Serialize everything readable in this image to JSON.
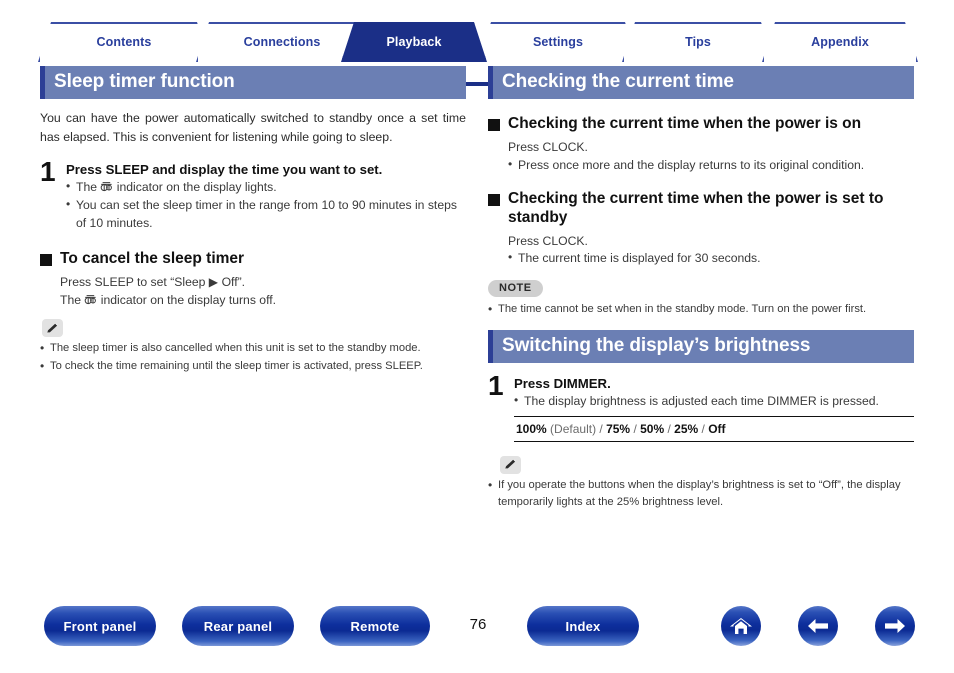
{
  "nav_tabs": [
    {
      "label": "Contents",
      "active": false
    },
    {
      "label": "Connections",
      "active": false
    },
    {
      "label": "Playback",
      "active": true
    },
    {
      "label": "Settings",
      "active": false
    },
    {
      "label": "Tips",
      "active": false
    },
    {
      "label": "Appendix",
      "active": false
    }
  ],
  "left_column": {
    "section_title": "Sleep timer function",
    "intro": "You can have the power automatically switched to standby once a set time has elapsed. This is convenient for listening while going to sleep.",
    "step": {
      "number": "1",
      "title": "Press SLEEP and display the time you want to set.",
      "bullet_1_pre": "The ",
      "bullet_1_post": " indicator on the display lights.",
      "bullet_2": "You can set the sleep timer in the range from 10 to 90 minutes in steps of 10 minutes."
    },
    "subhead": "To cancel the sleep timer",
    "sub_line_1": "Press SLEEP to set “Sleep ▶ Off”.",
    "sub_line_2_pre": "The ",
    "sub_line_2_post": " indicator on the display turns off.",
    "memo_bullets": [
      "The sleep timer is also cancelled when this unit is set to the standby mode.",
      "To check the time remaining until the sleep timer is activated, press SLEEP."
    ]
  },
  "right_column": {
    "section_title_1": "Checking the current time",
    "subhead_1": "Checking the current time when the power is on",
    "sub1_line": "Press CLOCK.",
    "sub1_bullet": "Press once more and the display returns to its original condition.",
    "subhead_2": "Checking the current time when the power is set to standby",
    "sub2_line": "Press CLOCK.",
    "sub2_bullet": "The current time is displayed for 30 seconds.",
    "note_badge": "NOTE",
    "note_bullet": "The time cannot be set when in the standby mode. Turn on the power first.",
    "section_title_2": "Switching the display’s brightness",
    "step": {
      "number": "1",
      "title": "Press DIMMER.",
      "bullet": "The display brightness is adjusted each time DIMMER is pressed."
    },
    "options": {
      "o1": "100%",
      "o1_note": "(Default)",
      "sep": " / ",
      "o2": "75%",
      "o3": "50%",
      "o4": "25%",
      "o5": "Off"
    },
    "memo_bullet": "If you operate the buttons when the display’s brightness is set to “Off”, the display temporarily lights at the 25% brightness level."
  },
  "bottom_nav": {
    "front_panel": "Front panel",
    "rear_panel": "Rear panel",
    "remote": "Remote",
    "page_number": "76",
    "index": "Index",
    "icons": [
      "home-icon",
      "arrow-left-icon",
      "arrow-right-icon"
    ]
  },
  "colors": {
    "tab_active_bg": "#1b2f87",
    "tab_text": "#2a3f9d",
    "section_bar_bg": "#6b7fb4",
    "section_bar_accent": "#2c3f96",
    "button_blue": "#0e2f9d",
    "note_badge_bg": "#cfcfcf",
    "memo_icon_bg": "#e2e2e2"
  }
}
